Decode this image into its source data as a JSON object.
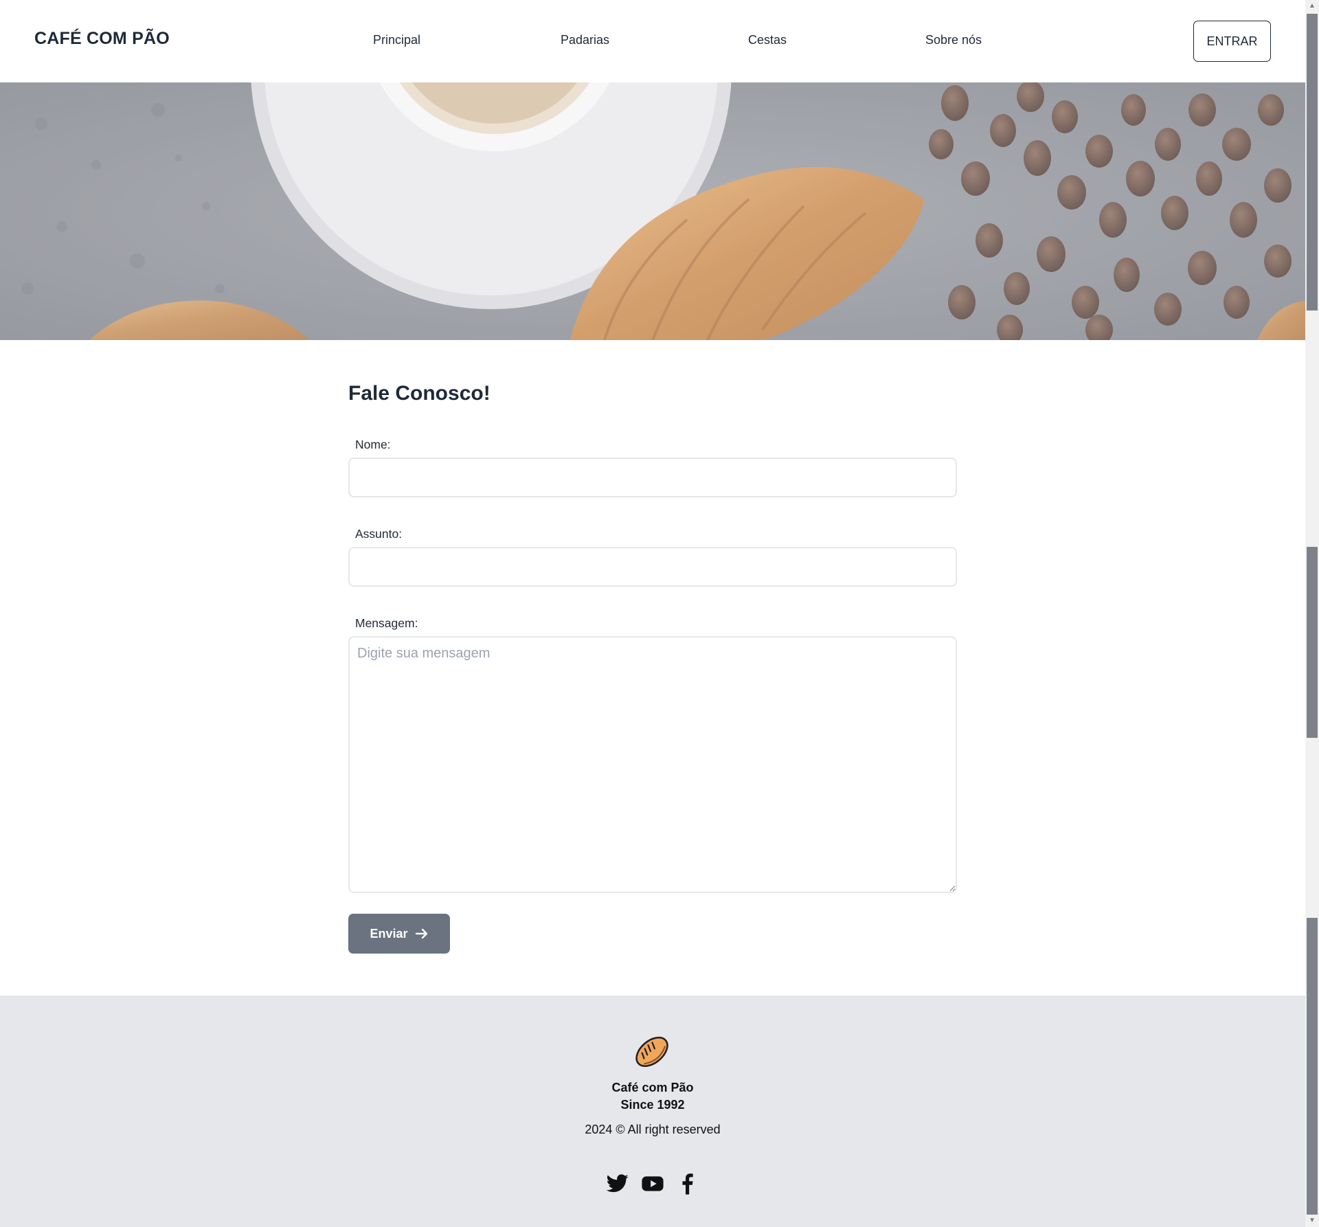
{
  "header": {
    "brand": "CAFÉ COM PÃO",
    "nav": [
      "Principal",
      "Padarias",
      "Cestas",
      "Sobre nós"
    ],
    "login_label": "ENTRAR"
  },
  "form": {
    "title": "Fale Conosco!",
    "name_label": "Nome:",
    "name_value": "",
    "subject_label": "Assunto:",
    "subject_value": "",
    "message_label": "Mensagem:",
    "message_placeholder": "Digite sua mensagem",
    "submit_label": "Enviar"
  },
  "footer": {
    "name": "Café com Pão",
    "since": "Since 1992",
    "copyright": "2024 © All right reserved",
    "social": [
      "twitter-icon",
      "youtube-icon",
      "facebook-icon"
    ]
  },
  "colors": {
    "text": "#1f2937",
    "button_bg": "#6b7280",
    "footer_bg": "#e5e7eb",
    "input_border": "#e5e7eb",
    "bread_fill": "#f2a65a"
  }
}
